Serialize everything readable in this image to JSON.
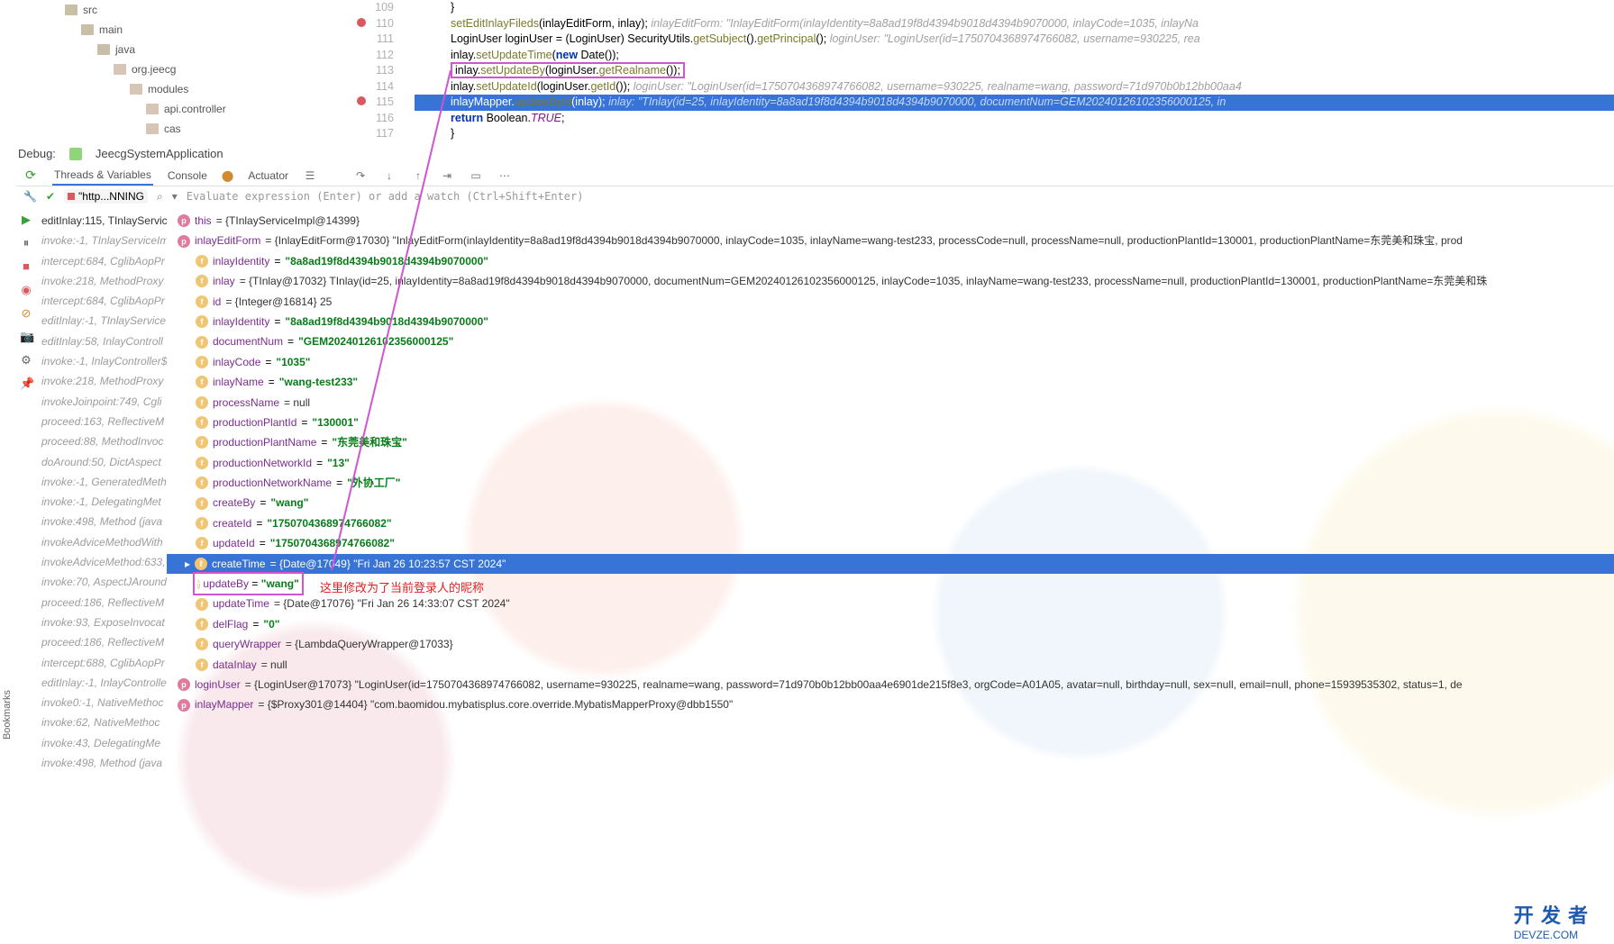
{
  "tree": [
    {
      "indent": 52,
      "label": "src",
      "type": "dir"
    },
    {
      "indent": 70,
      "label": "main",
      "type": "dir"
    },
    {
      "indent": 88,
      "label": "java",
      "type": "dir"
    },
    {
      "indent": 106,
      "label": "org.jeecg",
      "type": "pkg"
    },
    {
      "indent": 124,
      "label": "modules",
      "type": "pkg"
    },
    {
      "indent": 142,
      "label": "api.controller",
      "type": "pkg"
    },
    {
      "indent": 142,
      "label": "cas",
      "type": "pkg"
    }
  ],
  "code": {
    "gutter": [
      "109",
      "110",
      "111",
      "112",
      "113",
      "114",
      "115",
      "116",
      "117"
    ],
    "bp": [
      1,
      6
    ],
    "lines": [
      {
        "raw": "    }"
      },
      {
        "raw": "    setEditInlayFileds(inlayEditForm, inlay);",
        "hint": "inlayEditForm: \"InlayEditForm(inlayIdentity=8a8ad19f8d4394b9018d4394b9070000, inlayCode=1035, inlayNa"
      },
      {
        "raw": "    LoginUser loginUser = (LoginUser) SecurityUtils.getSubject().getPrincipal();",
        "hint": "loginUser: \"LoginUser(id=1750704368974766082, username=930225, rea"
      },
      {
        "raw": "    inlay.setUpdateTime(new Date());"
      },
      {
        "raw": "    inlay.setUpdateBy(loginUser.getRealname());",
        "boxed": true
      },
      {
        "raw": "    inlay.setUpdateId(loginUser.getId());",
        "hint": "loginUser: \"LoginUser(id=1750704368974766082, username=930225, realname=wang, password=71d970b0b12bb00aa4"
      },
      {
        "raw": "    inlayMapper.updateById(inlay);",
        "hl": true,
        "hint": "inlay: \"TInlay(id=25, inlayIdentity=8a8ad19f8d4394b9018d4394b9070000, documentNum=GEM20240126102356000125, in"
      },
      {
        "raw": "    return Boolean.TRUE;"
      },
      {
        "raw": "}"
      }
    ]
  },
  "debug": {
    "label": "Debug:",
    "app": "JeecgSystemApplication",
    "tabs": [
      "Threads & Variables",
      "Console",
      "Actuator"
    ],
    "chip": "\"http...NNING",
    "eval": "Evaluate expression (Enter) or add a watch (Ctrl+Shift+Enter)"
  },
  "frames": [
    {
      "t": "editInlay:115, TInlayServic",
      "active": true
    },
    {
      "t": "invoke:-1, TInlayServiceIm"
    },
    {
      "t": "intercept:684, CglibAopPr"
    },
    {
      "t": "invoke:218, MethodProxy"
    },
    {
      "t": "intercept:684, CglibAopPr"
    },
    {
      "t": "editInlay:-1, TInlayService"
    },
    {
      "t": "editInlay:58, InlayControll"
    },
    {
      "t": "invoke:-1, InlayController$"
    },
    {
      "t": "invoke:218, MethodProxy"
    },
    {
      "t": "invokeJoinpoint:749, Cgli"
    },
    {
      "t": "proceed:163, ReflectiveM"
    },
    {
      "t": "proceed:88, MethodInvoc"
    },
    {
      "t": "doAround:50, DictAspect"
    },
    {
      "t": "invoke:-1, GeneratedMeth"
    },
    {
      "t": "invoke:-1, DelegatingMet"
    },
    {
      "t": "invoke:498, Method (java"
    },
    {
      "t": "invokeAdviceMethodWith"
    },
    {
      "t": "invokeAdviceMethod:633,"
    },
    {
      "t": "invoke:70, AspectJAround"
    },
    {
      "t": "proceed:186, ReflectiveM"
    },
    {
      "t": "invoke:93, ExposeInvocat"
    },
    {
      "t": "proceed:186, ReflectiveM"
    },
    {
      "t": "intercept:688, CglibAopPr"
    },
    {
      "t": "editInlay:-1, InlayControlle"
    },
    {
      "t": "invoke0:-1, NativeMethoc"
    },
    {
      "t": "invoke:62, NativeMethoc"
    },
    {
      "t": "invoke:43, DelegatingMe"
    },
    {
      "t": "invoke:498, Method (java"
    }
  ],
  "vars": [
    {
      "name": "this",
      "val": "= {TInlayServiceImpl@14399}",
      "top": true,
      "badge": "p"
    },
    {
      "name": "inlayEditForm",
      "val": "= {InlayEditForm@17030} \"InlayEditForm(inlayIdentity=8a8ad19f8d4394b9018d4394b9070000, inlayCode=1035, inlayName=wang-test233, processCode=null, processName=null, productionPlantId=130001, productionPlantName=东莞美和珠宝, prod",
      "top": true,
      "badge": "p"
    },
    {
      "name": "inlayIdentity",
      "str": "\"8a8ad19f8d4394b9018d4394b9070000\""
    },
    {
      "name": "inlay",
      "val": "= {TInlay@17032} TInlay(id=25, inlayIdentity=8a8ad19f8d4394b9018d4394b9070000, documentNum=GEM20240126102356000125, inlayCode=1035, inlayName=wang-test233, processName=null, productionPlantId=130001, productionPlantName=东莞美和珠"
    },
    {
      "name": "id",
      "val": "= {Integer@16814} 25"
    },
    {
      "name": "inlayIdentity",
      "str": "\"8a8ad19f8d4394b9018d4394b9070000\""
    },
    {
      "name": "documentNum",
      "str": "\"GEM20240126102356000125\""
    },
    {
      "name": "inlayCode",
      "str": "\"1035\""
    },
    {
      "name": "inlayName",
      "str": "\"wang-test233\""
    },
    {
      "name": "processName",
      "val": "= null"
    },
    {
      "name": "productionPlantId",
      "str": "\"130001\""
    },
    {
      "name": "productionPlantName",
      "str": "\"东莞美和珠宝\""
    },
    {
      "name": "productionNetworkId",
      "str": "\"13\""
    },
    {
      "name": "productionNetworkName",
      "str": "\"外协工厂\""
    },
    {
      "name": "createBy",
      "str": "\"wang\""
    },
    {
      "name": "createId",
      "str": "\"1750704368974766082\""
    },
    {
      "name": "updateId",
      "str": "\"1750704368974766082\""
    },
    {
      "name": "createTime",
      "val": "= {Date@17049} \"Fri Jan 26 10:23:57 CST 2024\"",
      "sel": true
    },
    {
      "name": "updateBy",
      "str": "\"wang\"",
      "boxed": true
    },
    {
      "name": "updateTime",
      "val": "= {Date@17076} \"Fri Jan 26 14:33:07 CST 2024\""
    },
    {
      "name": "delFlag",
      "str": "\"0\""
    },
    {
      "name": "queryWrapper",
      "val": "= {LambdaQueryWrapper@17033}"
    },
    {
      "name": "dataInlay",
      "val": "= null"
    },
    {
      "name": "loginUser",
      "val": "= {LoginUser@17073} \"LoginUser(id=1750704368974766082, username=930225, realname=wang, password=71d970b0b12bb00aa4e6901de215f8e3, orgCode=A01A05, avatar=null, birthday=null, sex=null, email=null, phone=15939535302, status=1, de",
      "badge": "p"
    },
    {
      "name": "inlayMapper",
      "val": "= {$Proxy301@14404} \"com.baomidou.mybatisplus.core.override.MybatisMapperProxy@dbb1550\"",
      "badge": "p"
    }
  ],
  "annotation": "这里修改为了当前登录人的昵称",
  "watermark": {
    "big": "开 发 者",
    "small": "DEVZE.COM"
  },
  "bookmarks": "Bookmarks"
}
